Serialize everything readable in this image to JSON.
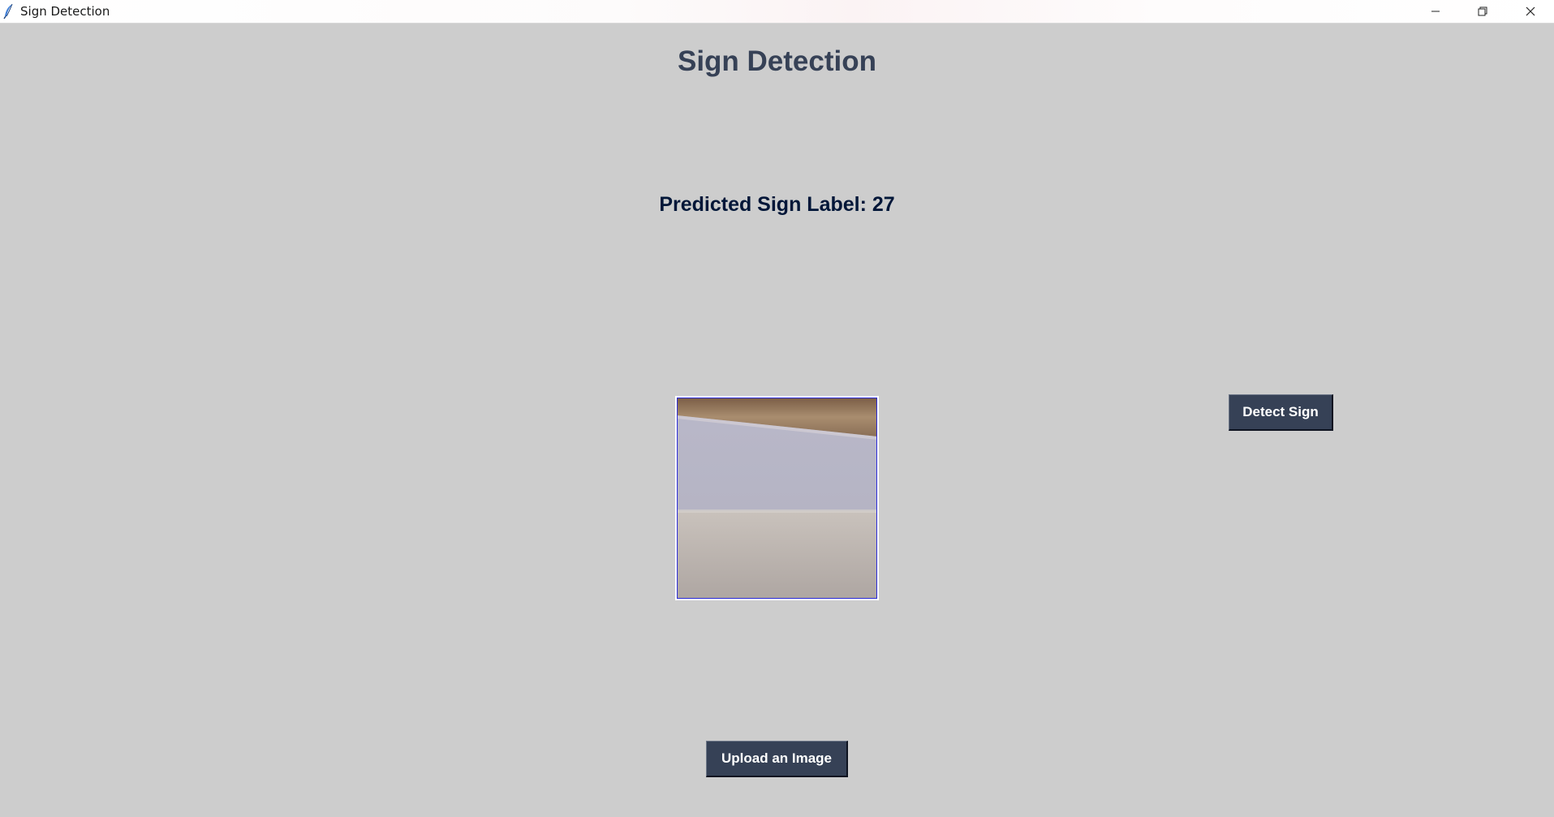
{
  "window": {
    "title": "Sign Detection",
    "app_icon": "feather-icon",
    "controls": {
      "minimize_icon": "minimize-icon",
      "restore_icon": "restore-icon",
      "close_icon": "close-icon"
    }
  },
  "main": {
    "heading": "Sign Detection",
    "prediction_text": "Predicted Sign Label: 27",
    "detect_button_label": "Detect Sign",
    "upload_button_label": "Upload an Image"
  },
  "colors": {
    "background": "#cdcdcd",
    "button_bg": "#364156",
    "button_text": "#ffffff",
    "heading_text": "#364156",
    "prediction_text": "#011638",
    "image_border": "#2a2ad8"
  }
}
